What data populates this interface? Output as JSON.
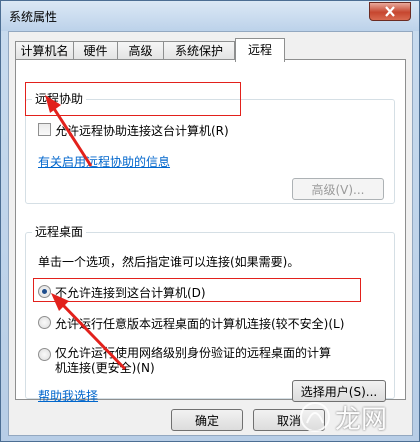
{
  "window": {
    "title": "系统属性"
  },
  "tabs": [
    "计算机名",
    "硬件",
    "高级",
    "系统保护",
    "远程"
  ],
  "remote_assistance": {
    "legend": "远程协助",
    "checkbox_label": "允许远程协助连接这台计算机(R)",
    "checked": false,
    "info_link": "有关启用远程协助的信息",
    "advanced_button": "高级(V)..."
  },
  "remote_desktop": {
    "legend": "远程桌面",
    "description": "单击一个选项，然后指定谁可以连接(如果需要)。",
    "options": [
      {
        "label": "不允许连接到这台计算机(D)",
        "selected": true
      },
      {
        "label": "允许运行任意版本远程桌面的计算机连接(较不安全)(L)",
        "selected": false
      },
      {
        "label_line1": "仅允许运行使用网络级别身份验证的远程桌面的计算",
        "label_line2": "机连接(更安全)(N)",
        "selected": false
      }
    ],
    "help_link": "帮助我选择",
    "select_users_button": "选择用户(S)..."
  },
  "footer": {
    "ok_button": "确定",
    "cancel_button": "取消"
  },
  "watermark": {
    "text": "龙网"
  },
  "colors": {
    "annotation_red": "#e2211c",
    "link_blue": "#0066cc"
  }
}
